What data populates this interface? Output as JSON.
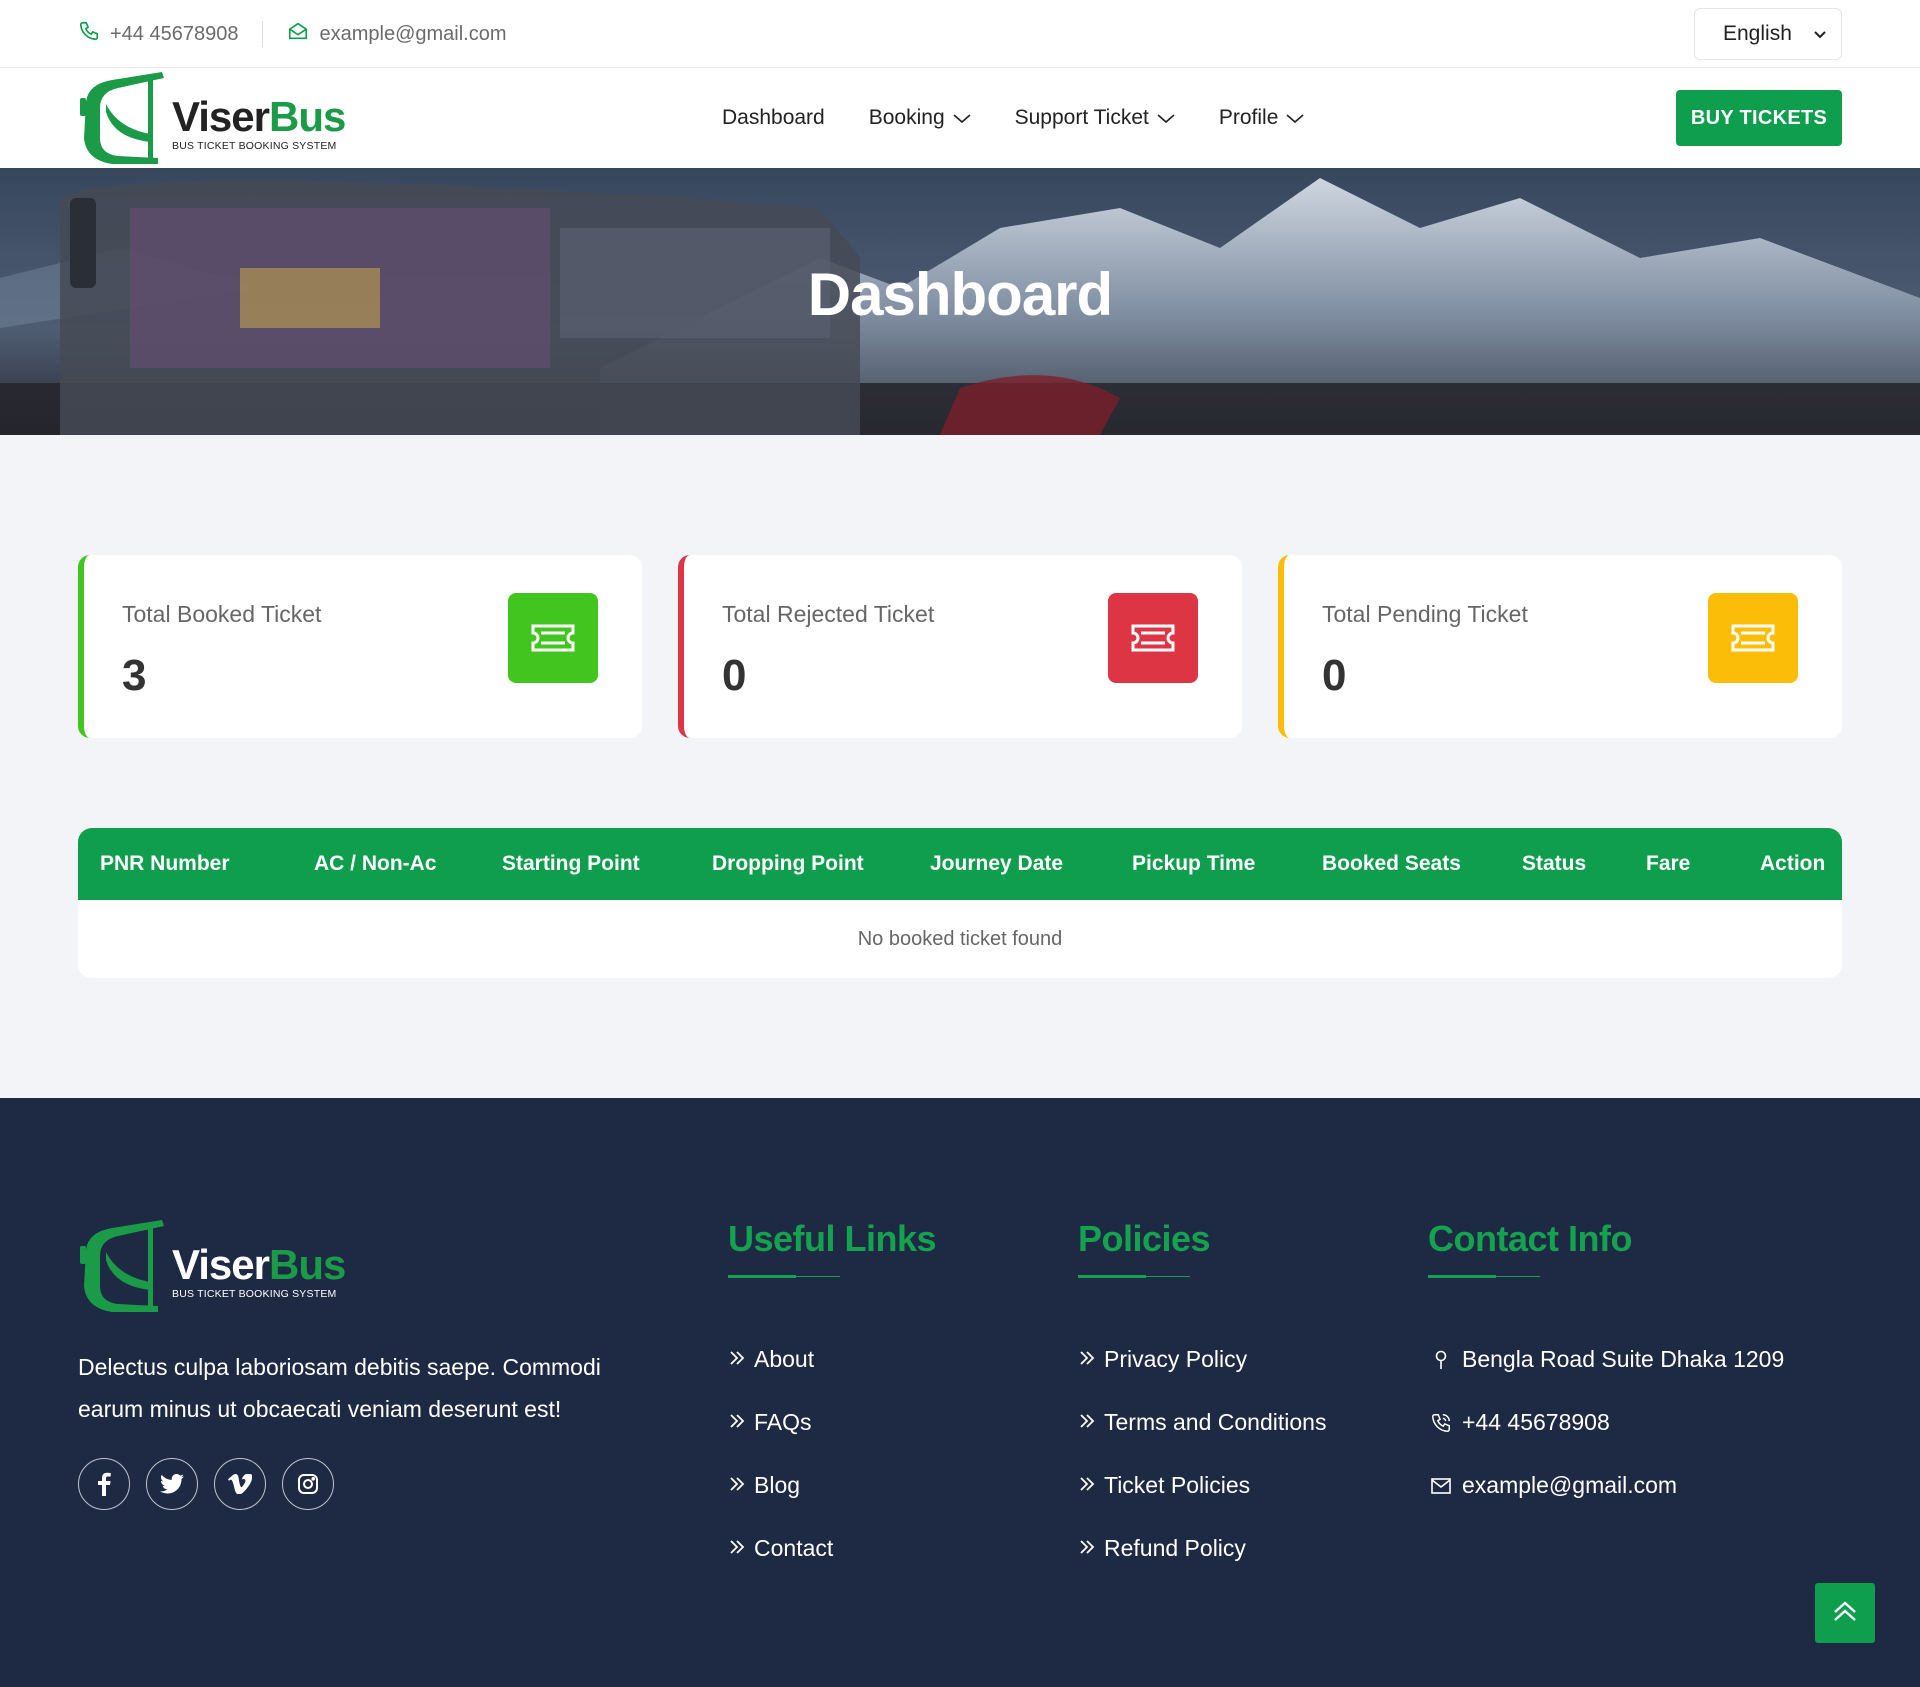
{
  "topbar": {
    "phone": "+44 45678908",
    "email": "example@gmail.com",
    "language": "English"
  },
  "logo": {
    "brand_first": "Viser",
    "brand_second": "Bus",
    "tagline": "BUS TICKET BOOKING SYSTEM"
  },
  "nav": {
    "items": [
      {
        "label": "Dashboard",
        "has_dropdown": false
      },
      {
        "label": "Booking",
        "has_dropdown": true
      },
      {
        "label": "Support Ticket",
        "has_dropdown": true
      },
      {
        "label": "Profile",
        "has_dropdown": true
      }
    ],
    "buy_button": "BUY TICKETS"
  },
  "hero": {
    "title": "Dashboard"
  },
  "stats": [
    {
      "label": "Total Booked Ticket",
      "value": "3",
      "color": "#42c61f"
    },
    {
      "label": "Total Rejected Ticket",
      "value": "0",
      "color": "#de3545"
    },
    {
      "label": "Total Pending Ticket",
      "value": "0",
      "color": "#fbbd08"
    }
  ],
  "table": {
    "headers": [
      "PNR Number",
      "AC / Non-Ac",
      "Starting Point",
      "Dropping Point",
      "Journey Date",
      "Pickup Time",
      "Booked Seats",
      "Status",
      "Fare",
      "Action"
    ],
    "empty_message": "No booked ticket found"
  },
  "footer": {
    "about": "Delectus culpa laboriosam debitis saepe. Commodi earum minus ut obcaecati veniam deserunt est!",
    "socials": [
      "facebook-icon",
      "twitter-icon",
      "vimeo-icon",
      "instagram-icon"
    ],
    "useful_links": {
      "title": "Useful Links",
      "items": [
        "About",
        "FAQs",
        "Blog",
        "Contact"
      ]
    },
    "policies": {
      "title": "Policies",
      "items": [
        "Privacy Policy",
        "Terms and Conditions",
        "Ticket Policies",
        "Refund Policy"
      ]
    },
    "contact": {
      "title": "Contact Info",
      "address": "Bengla Road Suite Dhaka 1209",
      "phone": "+44 45678908",
      "email": "example@gmail.com"
    }
  },
  "colors": {
    "accent": "#0e9e4d",
    "footer_bg": "#1e2a43",
    "page_bg": "#f3f4f7"
  }
}
